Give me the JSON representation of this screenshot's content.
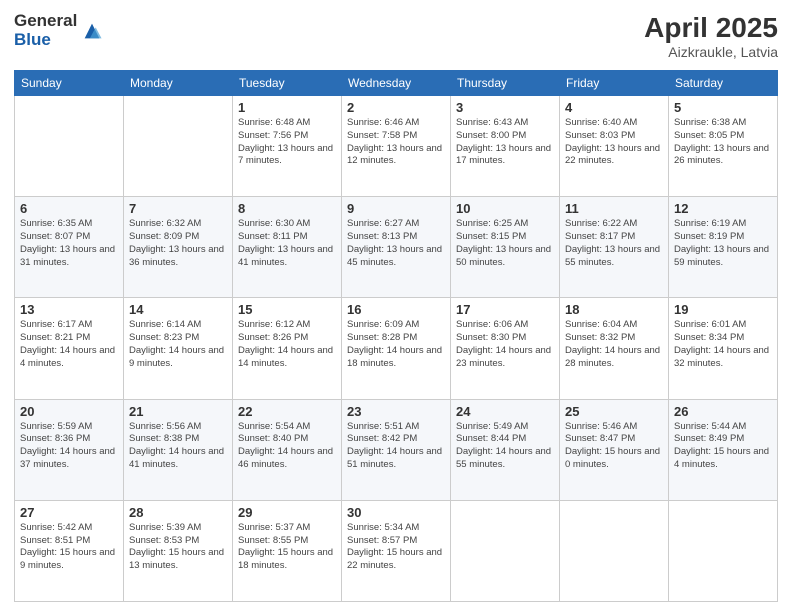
{
  "header": {
    "logo_general": "General",
    "logo_blue": "Blue",
    "month_title": "April 2025",
    "location": "Aizkraukle, Latvia"
  },
  "calendar": {
    "days_of_week": [
      "Sunday",
      "Monday",
      "Tuesday",
      "Wednesday",
      "Thursday",
      "Friday",
      "Saturday"
    ],
    "weeks": [
      [
        {
          "day": "",
          "info": ""
        },
        {
          "day": "",
          "info": ""
        },
        {
          "day": "1",
          "info": "Sunrise: 6:48 AM\nSunset: 7:56 PM\nDaylight: 13 hours and 7 minutes."
        },
        {
          "day": "2",
          "info": "Sunrise: 6:46 AM\nSunset: 7:58 PM\nDaylight: 13 hours and 12 minutes."
        },
        {
          "day": "3",
          "info": "Sunrise: 6:43 AM\nSunset: 8:00 PM\nDaylight: 13 hours and 17 minutes."
        },
        {
          "day": "4",
          "info": "Sunrise: 6:40 AM\nSunset: 8:03 PM\nDaylight: 13 hours and 22 minutes."
        },
        {
          "day": "5",
          "info": "Sunrise: 6:38 AM\nSunset: 8:05 PM\nDaylight: 13 hours and 26 minutes."
        }
      ],
      [
        {
          "day": "6",
          "info": "Sunrise: 6:35 AM\nSunset: 8:07 PM\nDaylight: 13 hours and 31 minutes."
        },
        {
          "day": "7",
          "info": "Sunrise: 6:32 AM\nSunset: 8:09 PM\nDaylight: 13 hours and 36 minutes."
        },
        {
          "day": "8",
          "info": "Sunrise: 6:30 AM\nSunset: 8:11 PM\nDaylight: 13 hours and 41 minutes."
        },
        {
          "day": "9",
          "info": "Sunrise: 6:27 AM\nSunset: 8:13 PM\nDaylight: 13 hours and 45 minutes."
        },
        {
          "day": "10",
          "info": "Sunrise: 6:25 AM\nSunset: 8:15 PM\nDaylight: 13 hours and 50 minutes."
        },
        {
          "day": "11",
          "info": "Sunrise: 6:22 AM\nSunset: 8:17 PM\nDaylight: 13 hours and 55 minutes."
        },
        {
          "day": "12",
          "info": "Sunrise: 6:19 AM\nSunset: 8:19 PM\nDaylight: 13 hours and 59 minutes."
        }
      ],
      [
        {
          "day": "13",
          "info": "Sunrise: 6:17 AM\nSunset: 8:21 PM\nDaylight: 14 hours and 4 minutes."
        },
        {
          "day": "14",
          "info": "Sunrise: 6:14 AM\nSunset: 8:23 PM\nDaylight: 14 hours and 9 minutes."
        },
        {
          "day": "15",
          "info": "Sunrise: 6:12 AM\nSunset: 8:26 PM\nDaylight: 14 hours and 14 minutes."
        },
        {
          "day": "16",
          "info": "Sunrise: 6:09 AM\nSunset: 8:28 PM\nDaylight: 14 hours and 18 minutes."
        },
        {
          "day": "17",
          "info": "Sunrise: 6:06 AM\nSunset: 8:30 PM\nDaylight: 14 hours and 23 minutes."
        },
        {
          "day": "18",
          "info": "Sunrise: 6:04 AM\nSunset: 8:32 PM\nDaylight: 14 hours and 28 minutes."
        },
        {
          "day": "19",
          "info": "Sunrise: 6:01 AM\nSunset: 8:34 PM\nDaylight: 14 hours and 32 minutes."
        }
      ],
      [
        {
          "day": "20",
          "info": "Sunrise: 5:59 AM\nSunset: 8:36 PM\nDaylight: 14 hours and 37 minutes."
        },
        {
          "day": "21",
          "info": "Sunrise: 5:56 AM\nSunset: 8:38 PM\nDaylight: 14 hours and 41 minutes."
        },
        {
          "day": "22",
          "info": "Sunrise: 5:54 AM\nSunset: 8:40 PM\nDaylight: 14 hours and 46 minutes."
        },
        {
          "day": "23",
          "info": "Sunrise: 5:51 AM\nSunset: 8:42 PM\nDaylight: 14 hours and 51 minutes."
        },
        {
          "day": "24",
          "info": "Sunrise: 5:49 AM\nSunset: 8:44 PM\nDaylight: 14 hours and 55 minutes."
        },
        {
          "day": "25",
          "info": "Sunrise: 5:46 AM\nSunset: 8:47 PM\nDaylight: 15 hours and 0 minutes."
        },
        {
          "day": "26",
          "info": "Sunrise: 5:44 AM\nSunset: 8:49 PM\nDaylight: 15 hours and 4 minutes."
        }
      ],
      [
        {
          "day": "27",
          "info": "Sunrise: 5:42 AM\nSunset: 8:51 PM\nDaylight: 15 hours and 9 minutes."
        },
        {
          "day": "28",
          "info": "Sunrise: 5:39 AM\nSunset: 8:53 PM\nDaylight: 15 hours and 13 minutes."
        },
        {
          "day": "29",
          "info": "Sunrise: 5:37 AM\nSunset: 8:55 PM\nDaylight: 15 hours and 18 minutes."
        },
        {
          "day": "30",
          "info": "Sunrise: 5:34 AM\nSunset: 8:57 PM\nDaylight: 15 hours and 22 minutes."
        },
        {
          "day": "",
          "info": ""
        },
        {
          "day": "",
          "info": ""
        },
        {
          "day": "",
          "info": ""
        }
      ]
    ]
  }
}
